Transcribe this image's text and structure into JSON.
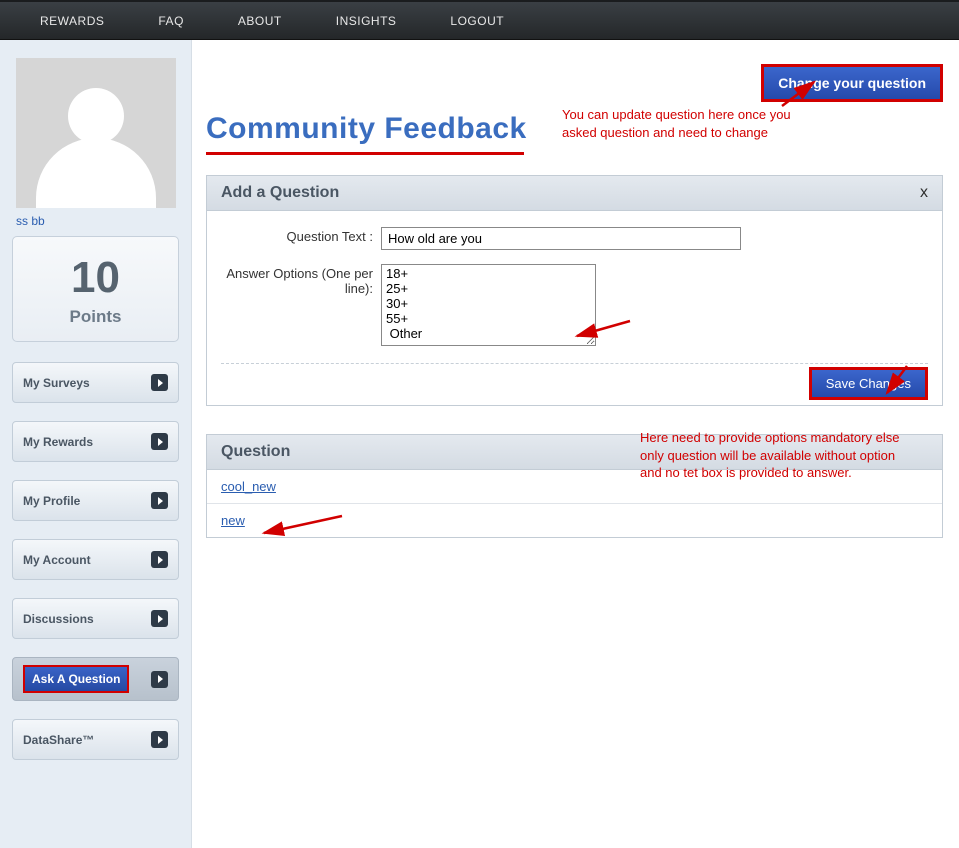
{
  "nav": {
    "items": [
      "REWARDS",
      "FAQ",
      "ABOUT",
      "INSIGHTS",
      "LOGOUT"
    ]
  },
  "sidebar": {
    "username": "ss bb",
    "points_value": "10",
    "points_label": "Points",
    "items": [
      {
        "label": "My Surveys"
      },
      {
        "label": "My Rewards"
      },
      {
        "label": "My Profile"
      },
      {
        "label": "My Account"
      },
      {
        "label": "Discussions"
      },
      {
        "label": "Ask A Question",
        "active": true
      },
      {
        "label": "DataShare™"
      }
    ]
  },
  "main": {
    "title": "Community Feedback",
    "change_button": "Change your question",
    "annotation1": "You can update question here once you asked question and need to change",
    "annotation2": "Here need to provide options mandatory else only question will be available without option and no tet box is provided to answer.",
    "add_panel": {
      "heading": "Add a Question",
      "close": "x",
      "question_label": "Question Text :",
      "question_value": "How old are you",
      "options_label": "Answer Options (One per line):",
      "options_value": "18+\n25+\n30+\n55+\n Other",
      "save_label": "Save Changes"
    },
    "question_list": {
      "heading": "Question",
      "items": [
        "cool_new",
        "new"
      ]
    }
  }
}
